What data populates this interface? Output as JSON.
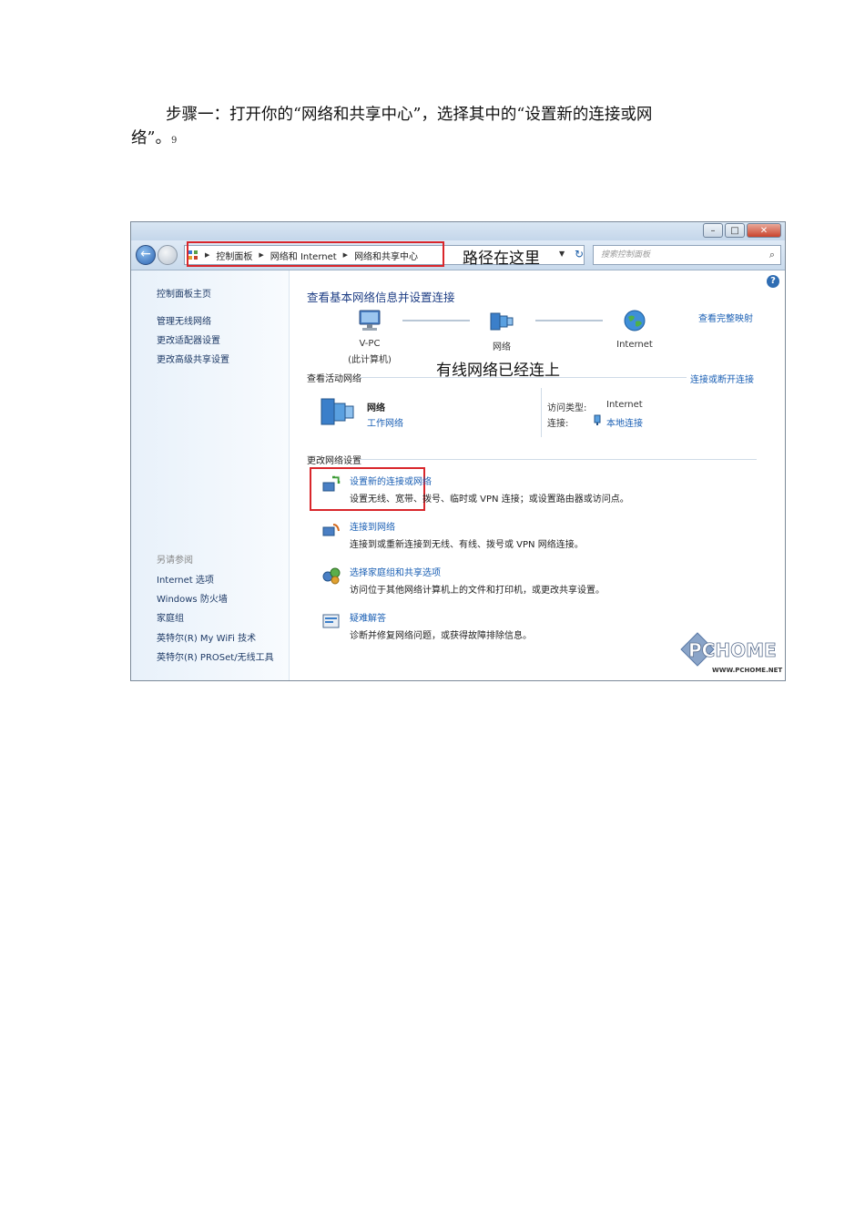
{
  "instruction": {
    "line1": "步骤一：打开你的“网络和共享中心”，选择其中的“设置新的连接或网",
    "line2": "络”。",
    "marker": "9"
  },
  "window": {
    "breadcrumb": [
      "控制面板",
      "网络和 Internet",
      "网络和共享中心"
    ],
    "path_annotation": "路径在这里",
    "search_placeholder": "搜索控制面板"
  },
  "sidebar": {
    "home": "控制面板主页",
    "items": [
      "管理无线网络",
      "更改适配器设置",
      "更改高级共享设置"
    ],
    "see_also_title": "另请参阅",
    "see_also": [
      "Internet 选项",
      "Windows 防火墙",
      "家庭组",
      "英特尔(R) My WiFi 技术",
      "英特尔(R) PROSet/无线工具"
    ]
  },
  "main": {
    "title": "查看基本网络信息并设置连接",
    "view_full_map": "查看完整映射",
    "map_nodes": [
      {
        "label": "V-PC",
        "sub": "(此计算机)"
      },
      {
        "label": "网络",
        "sub": ""
      },
      {
        "label": "Internet",
        "sub": ""
      }
    ],
    "wired_annotation": "有线网络已经连上",
    "active_networks_title": "查看活动网络",
    "connect_disconnect": "连接或断开连接",
    "network_name": "网络",
    "network_type": "工作网络",
    "access_type_label": "访问类型:",
    "access_type_value": "Internet",
    "connection_label": "连接:",
    "connection_value": "本地连接",
    "change_settings_title": "更改网络设置",
    "tasks": [
      {
        "title": "设置新的连接或网络",
        "desc": "设置无线、宽带、拨号、临时或 VPN 连接；或设置路由器或访问点。"
      },
      {
        "title": "连接到网络",
        "desc": "连接到或重新连接到无线、有线、拨号或 VPN 网络连接。"
      },
      {
        "title": "选择家庭组和共享选项",
        "desc": "访问位于其他网络计算机上的文件和打印机，或更改共享设置。"
      },
      {
        "title": "疑难解答",
        "desc": "诊断并修复网络问题，或获得故障排除信息。"
      }
    ]
  },
  "watermark": {
    "logo": "PCHOME",
    "url": "WWW.PCHOME.NET"
  }
}
